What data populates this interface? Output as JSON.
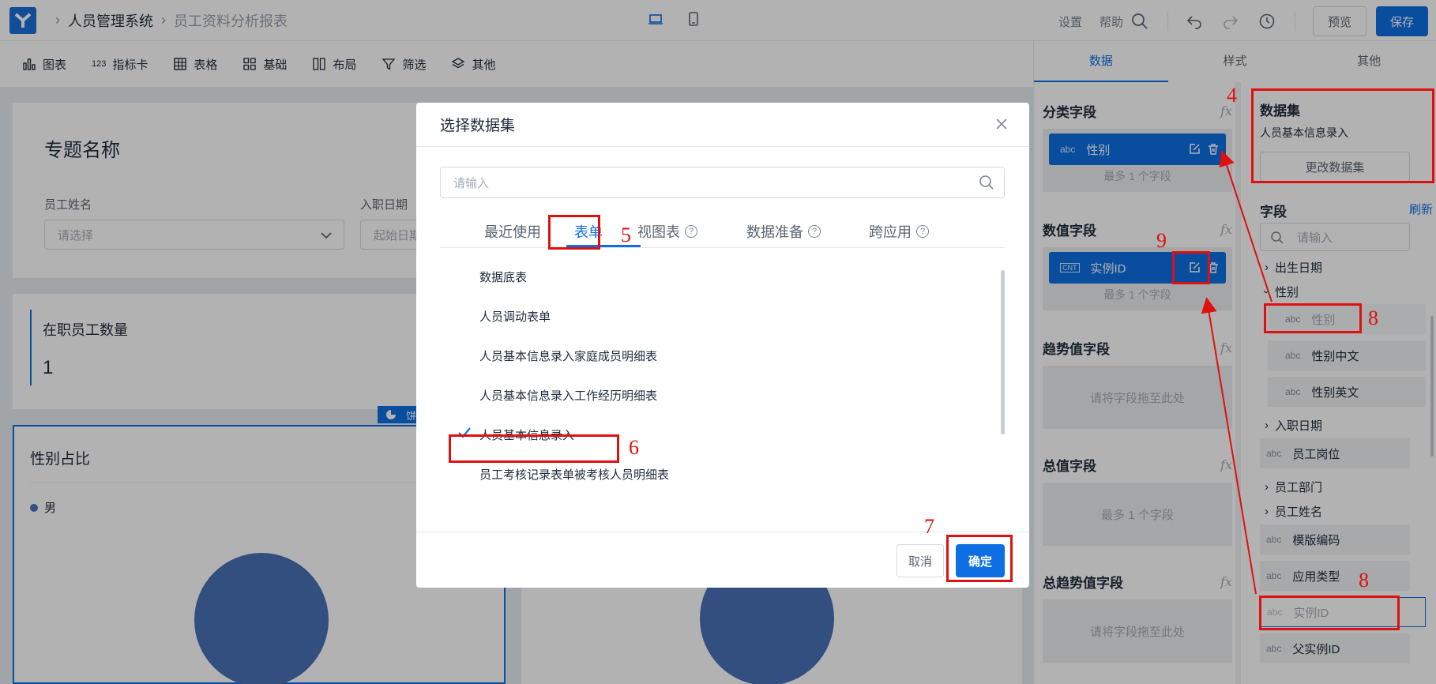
{
  "header": {
    "app_name": "人员管理系统",
    "report_name": "员工资料分析报表",
    "settings": "设置",
    "help": "帮助",
    "preview": "预览",
    "save": "保存"
  },
  "toolbar": {
    "items": [
      "图表",
      "指标卡",
      "表格",
      "基础",
      "布局",
      "筛选",
      "其他"
    ]
  },
  "canvas": {
    "topic_title": "专题名称",
    "filter1_label": "员工姓名",
    "filter1_placeholder": "请选择",
    "filter2_label": "入职日期",
    "filter2_placeholder": "起始日期",
    "kpi_title": "在职员工数量",
    "kpi_value": "1",
    "pie_title": "性别占比",
    "legend_item": "男",
    "tag_text": "饼"
  },
  "right_tabs": [
    "数据",
    "样式",
    "其他"
  ],
  "config": {
    "category_label": "分类字段",
    "category_chip": "性别",
    "category_chip_type": "abc",
    "category_hint": "最多 1 个字段",
    "value_label": "数值字段",
    "value_chip": "实例ID",
    "value_chip_type": "CNT",
    "value_hint": "最多 1 个字段",
    "trend_label": "趋势值字段",
    "trend_hint": "请将字段拖至此处",
    "total_label": "总值字段",
    "total_hint": "最多 1 个字段",
    "total_trend_label": "总趋势值字段",
    "total_trend_hint": "请将字段拖至此处",
    "fx": "fx"
  },
  "dataset": {
    "title": "数据集",
    "name": "人员基本信息录入",
    "change_button": "更改数据集",
    "fields_title": "字段",
    "refresh": "刷新",
    "search_placeholder": "请输入",
    "tree": {
      "birth": "出生日期",
      "gender": "性别",
      "gender_leaf": "性别",
      "gender_cn": "性别中文",
      "gender_en": "性别英文",
      "join_date": "入职日期",
      "position": "员工岗位",
      "dept": "员工部门",
      "emp_name": "员工姓名",
      "template_code": "模版编码",
      "app_type": "应用类型",
      "instance_id": "实例ID",
      "parent_instance_id": "父实例ID",
      "abc": "abc"
    }
  },
  "modal": {
    "title": "选择数据集",
    "search_placeholder": "请输入",
    "tabs": [
      "最近使用",
      "表单",
      "视图表",
      "数据准备",
      "跨应用"
    ],
    "items": [
      "数据底表",
      "人员调动表单",
      "人员基本信息录入家庭成员明细表",
      "人员基本信息录入工作经历明细表",
      "人员基本信息录入",
      "员工考核记录表单被考核人员明细表"
    ],
    "selected_index": 4,
    "cancel": "取消",
    "confirm": "确定"
  },
  "annotations": [
    "4",
    "5",
    "6",
    "7",
    "8",
    "8",
    "8",
    "9"
  ],
  "colors": {
    "primary": "#0d6fe3",
    "annotation_red": "#e01010",
    "pie": "#4a72b8"
  }
}
